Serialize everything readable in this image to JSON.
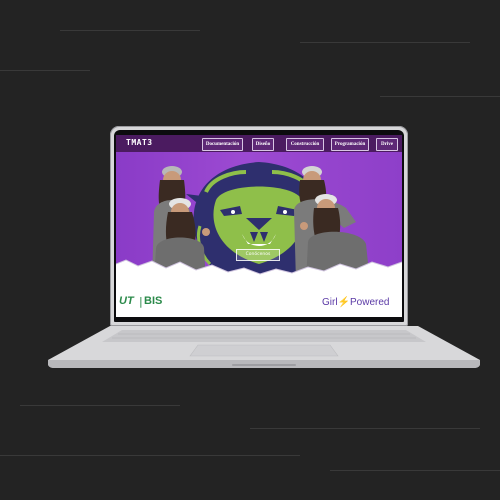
{
  "site": {
    "brand": "TMAT3",
    "nav": [
      {
        "label": "Documentación"
      },
      {
        "label": "Diseño"
      },
      {
        "label": "Construcción"
      },
      {
        "label": "Programación"
      },
      {
        "label": "Drive"
      }
    ],
    "cta_label": "Conócenos",
    "footer": {
      "logo_ut": "UT",
      "logo_separator": "|",
      "logo_bis": "BIS",
      "girl_powered_left": "Girl",
      "girl_powered_bolt": "⚡",
      "girl_powered_right": "Powered"
    }
  },
  "colors": {
    "background": "#232323",
    "navbar": "#4b1b60",
    "hero_purple": "#9c4ad2",
    "lion_green": "#8fbf4a",
    "lion_navy": "#2e2f6e",
    "logo_green": "#2b8a4a",
    "accent_pink": "#e0348a"
  },
  "icons": [
    "lion-mascot-icon",
    "lightning-icon"
  ]
}
